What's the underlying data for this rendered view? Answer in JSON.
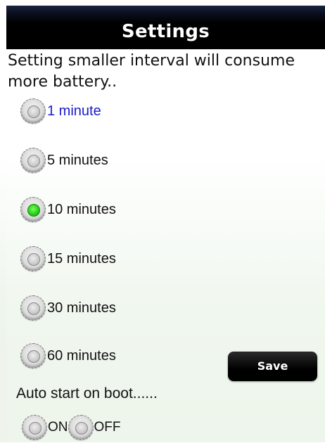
{
  "header": {
    "title": "Settings"
  },
  "notice": "Setting  smaller interval will consume more battery..",
  "interval_options": [
    {
      "label": "1 minute",
      "checked": false,
      "highlighted": true
    },
    {
      "label": "5 minutes",
      "checked": false,
      "highlighted": false
    },
    {
      "label": "10 minutes",
      "checked": true,
      "highlighted": false
    },
    {
      "label": "15 minutes",
      "checked": false,
      "highlighted": false
    },
    {
      "label": "30 minutes",
      "checked": false,
      "highlighted": false
    },
    {
      "label": "60 minutes",
      "checked": false,
      "highlighted": false
    }
  ],
  "save_label": "Save",
  "auto_start": {
    "label": "Auto start on boot......",
    "on_label": "ON",
    "off_label": "OFF"
  },
  "colors": {
    "title_bar": "#000000",
    "checked_radio": "#28d21a",
    "highlight_text": "#1a1acc"
  }
}
